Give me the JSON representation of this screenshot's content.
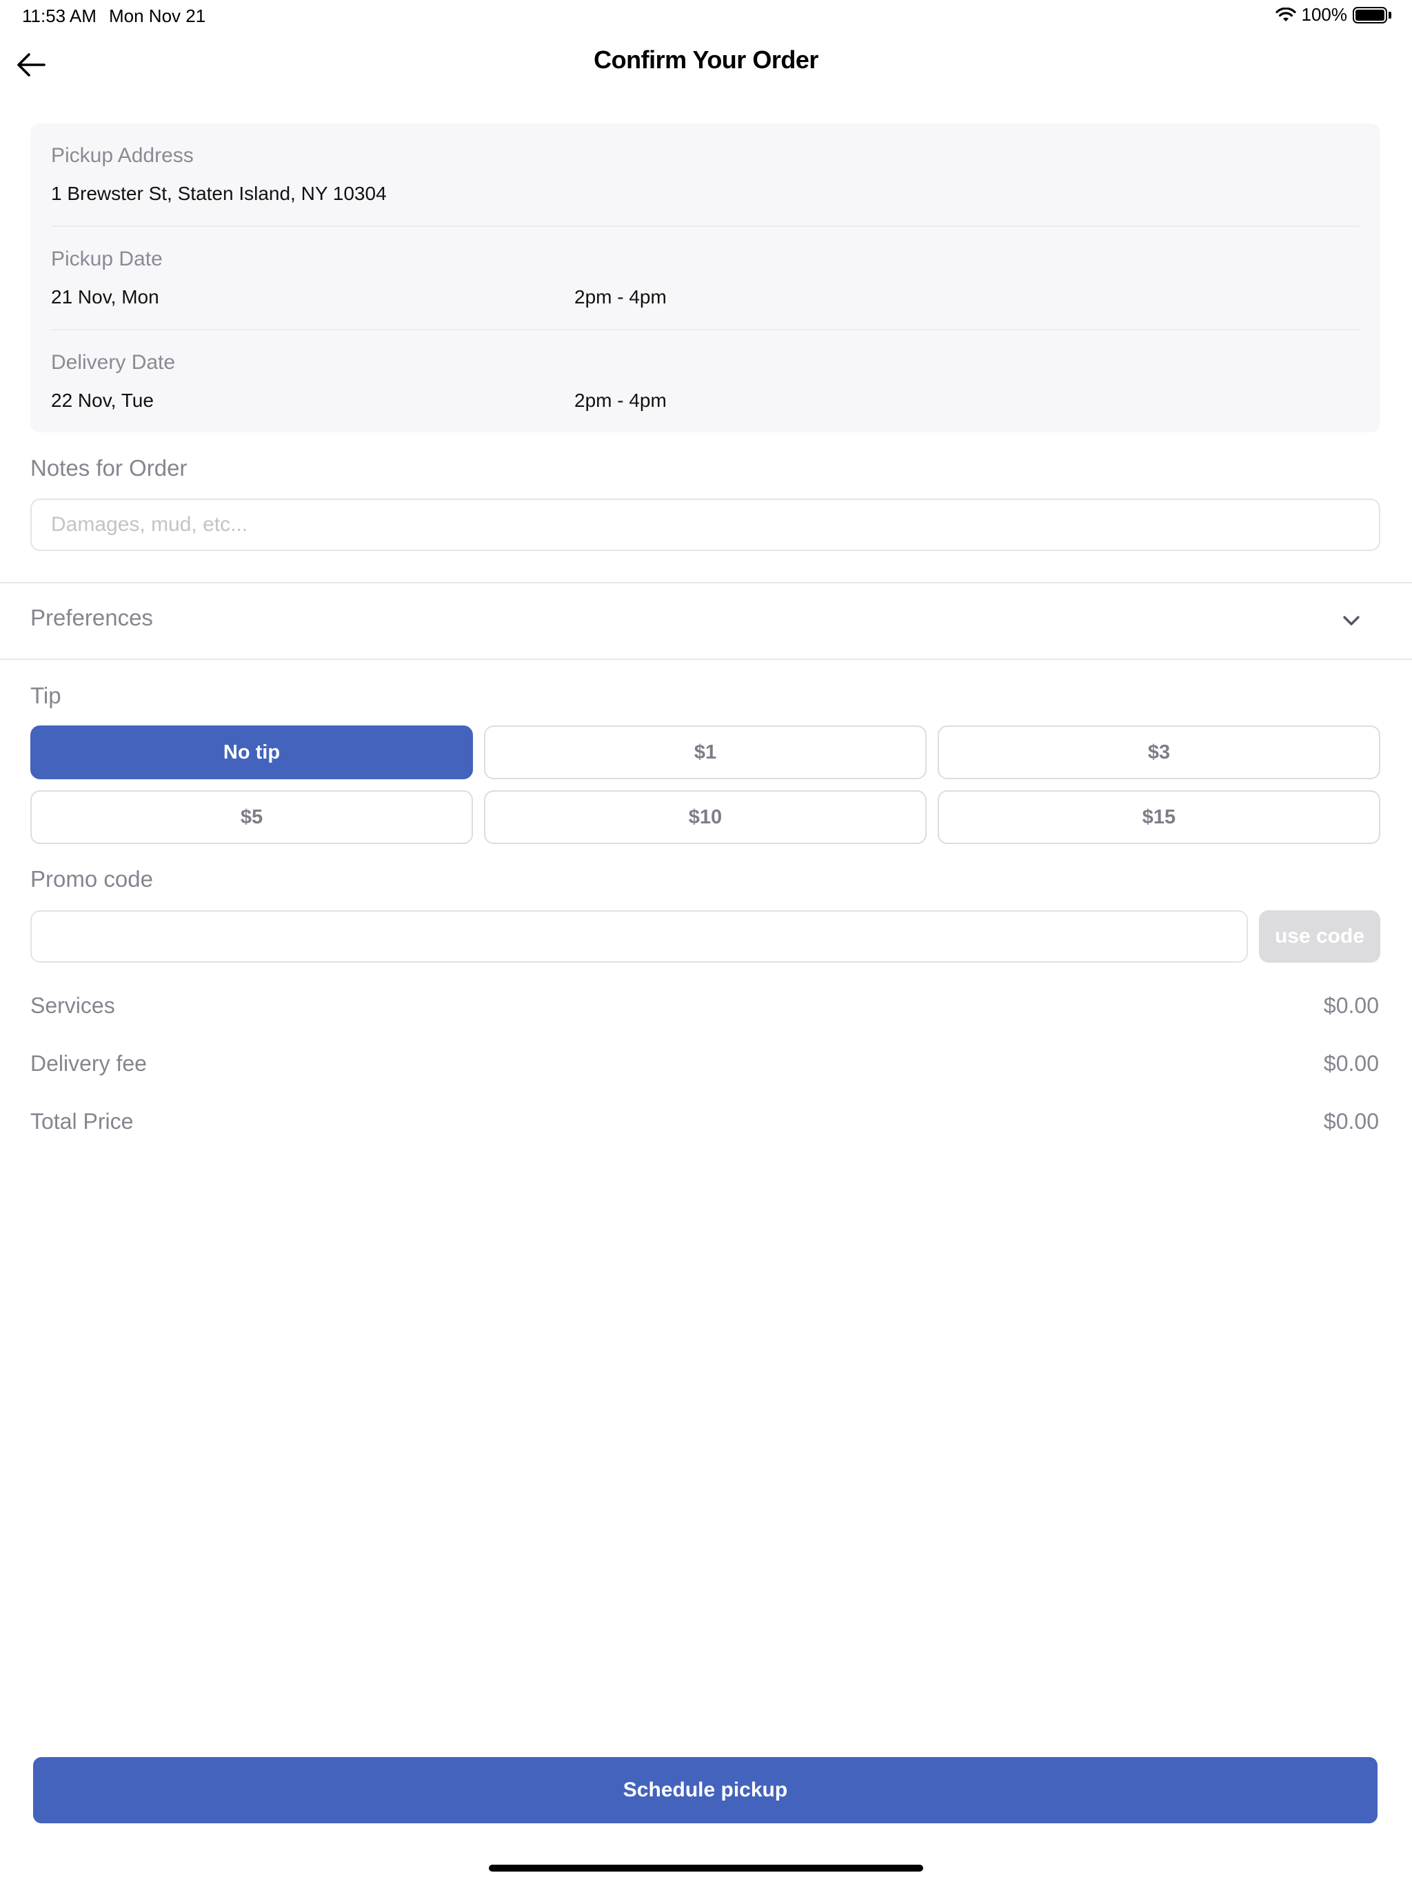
{
  "status_bar": {
    "time": "11:53 AM",
    "date": "Mon Nov 21",
    "battery": "100%"
  },
  "header": {
    "title": "Confirm Your Order",
    "back_icon": "arrow-left-icon"
  },
  "summary": {
    "pickup_address_label": "Pickup Address",
    "pickup_address_value": "1 Brewster St, Staten Island, NY 10304",
    "pickup_date_label": "Pickup Date",
    "pickup_date_value": "21 Nov, Mon",
    "pickup_time_value": "2pm - 4pm",
    "delivery_date_label": "Delivery Date",
    "delivery_date_value": "22 Nov, Tue",
    "delivery_time_value": "2pm - 4pm"
  },
  "notes": {
    "label": "Notes for Order",
    "placeholder": "Damages, mud, etc...",
    "value": ""
  },
  "preferences": {
    "label": "Preferences",
    "icon": "chevron-down-icon"
  },
  "tip": {
    "label": "Tip",
    "options": [
      "No tip",
      "$1",
      "$3",
      "$5",
      "$10",
      "$15"
    ],
    "selected": "No tip"
  },
  "promo": {
    "label": "Promo code",
    "value": "",
    "button_label": "use code"
  },
  "pricing": {
    "services_label": "Services",
    "services_value": "$0.00",
    "delivery_fee_label": "Delivery fee",
    "delivery_fee_value": "$0.00",
    "total_label": "Total Price",
    "total_value": "$0.00"
  },
  "actions": {
    "schedule_label": "Schedule pickup"
  },
  "colors": {
    "accent": "#4363bd",
    "muted_text": "#858590",
    "card_bg": "#f7f7f9"
  }
}
